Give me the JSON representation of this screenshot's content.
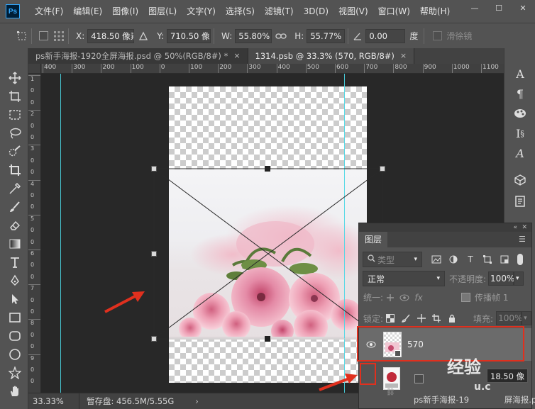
{
  "app": {
    "logo": "Ps"
  },
  "menu": [
    "文件(F)",
    "编辑(E)",
    "图像(I)",
    "图层(L)",
    "文字(Y)",
    "选择(S)",
    "滤镜(T)",
    "3D(D)",
    "视图(V)",
    "窗口(W)",
    "帮助(H)"
  ],
  "window_controls": {
    "minimize": "—",
    "maximize": "☐",
    "close": "✕"
  },
  "options": {
    "x_label": "X:",
    "x_value": "418.50 像素",
    "y_label": "Y:",
    "y_value": "710.50 像素",
    "w_label": "W:",
    "w_value": "55.80%",
    "h_label": "H:",
    "h_value": "55.77%",
    "angle_value": "0.00",
    "angle_unit": "度",
    "interp_label": "滑徐镜"
  },
  "tabs": [
    {
      "label": "ps新手海报-1920全屏海报.psd @ 50%(RGB/8#) *",
      "close": "×",
      "active": false
    },
    {
      "label": "1314.psb @ 33.3% (570, RGB/8#)",
      "close": "×",
      "active": true
    }
  ],
  "ruler": {
    "top": [
      "400",
      "300",
      "200",
      "100",
      "0",
      "100",
      "200",
      "300",
      "400",
      "500",
      "600",
      "700",
      "800",
      "900",
      "1000",
      "1100",
      "1200",
      "1300"
    ],
    "left": [
      "1",
      "0",
      "0",
      "2",
      "0",
      "0",
      "3",
      "0",
      "0",
      "4",
      "0",
      "0",
      "5",
      "0",
      "0",
      "6",
      "0",
      "0",
      "7",
      "0",
      "0",
      "8",
      "0",
      "0",
      "9",
      "0",
      "0"
    ]
  },
  "layers_panel": {
    "tab": "图层",
    "filter_label": "类型",
    "blend_mode": "正常",
    "opacity_label": "不透明度:",
    "opacity_value": "100%",
    "unify_label": "统一:",
    "propagate_label": "传播帧 1",
    "lock_label": "锁定:",
    "fill_label": "填充:",
    "fill_value": "100%",
    "layers": [
      {
        "name": "570",
        "selected": true
      },
      {
        "name": "",
        "selected": false
      }
    ]
  },
  "status": {
    "zoom": "33.33%",
    "doc_info": "暂存盘: 456.5M/5.55G",
    "arrow": "›"
  },
  "tooltip": "18.50 像",
  "bottom_tab": "ps新手海报-19",
  "bottom_tab2": "屏海报.ps",
  "watermark": "经验",
  "watermark_sub": "u.c",
  "colors": {
    "accent_red": "#e0301e",
    "guide": "#4ad7e4",
    "panel": "#535353"
  }
}
